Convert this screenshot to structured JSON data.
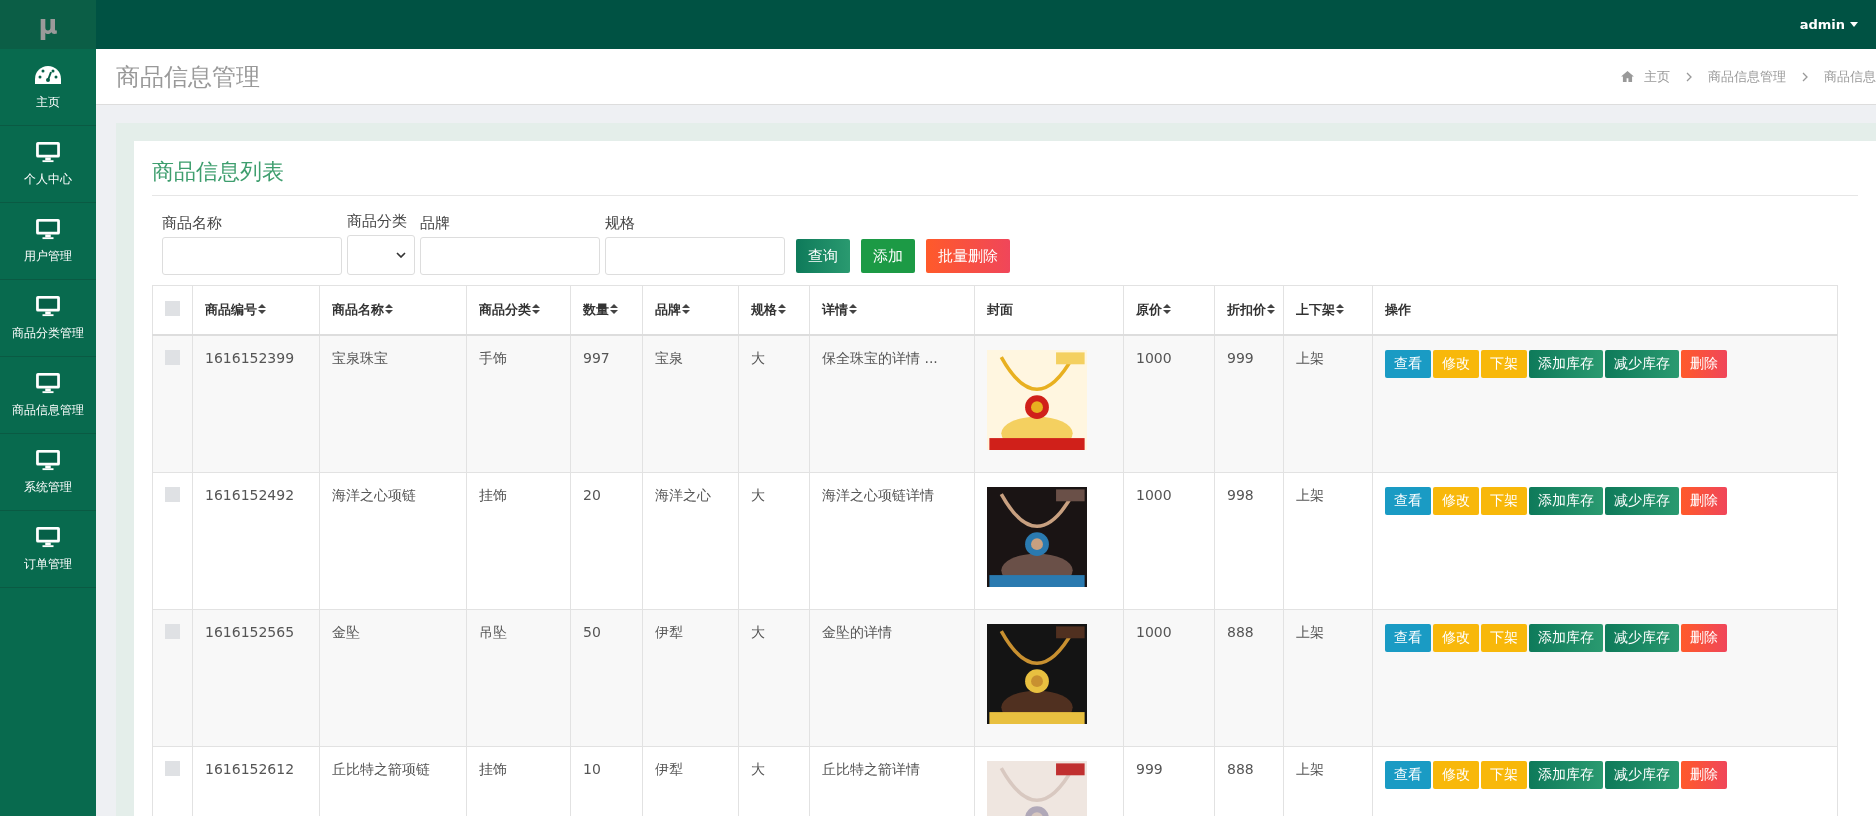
{
  "logo": "μ",
  "sidebar": {
    "items": [
      {
        "label": "主页",
        "selected": false
      },
      {
        "label": "个人中心",
        "selected": false
      },
      {
        "label": "用户管理",
        "selected": false
      },
      {
        "label": "商品分类管理",
        "selected": false
      },
      {
        "label": "商品信息管理",
        "selected": false
      },
      {
        "label": "系统管理",
        "selected": false
      },
      {
        "label": "订单管理",
        "selected": false
      }
    ]
  },
  "topbar": {
    "user": "admin"
  },
  "page_title": "商品信息管理",
  "breadcrumb": [
    "主页",
    "商品信息管理",
    "商品信息"
  ],
  "card_title": "商品信息列表",
  "filters": [
    {
      "label": "商品名称",
      "kind": "text"
    },
    {
      "label": "商品分类",
      "kind": "select"
    },
    {
      "label": "品牌",
      "kind": "text"
    },
    {
      "label": "规格",
      "kind": "text"
    }
  ],
  "actions": [
    {
      "label": "查询",
      "kind": "search"
    },
    {
      "label": "添加",
      "kind": "add"
    },
    {
      "label": "批量删除",
      "kind": "danger"
    }
  ],
  "table": {
    "all_checked": false,
    "columns": [
      {
        "label": "商品编号",
        "sortable": true
      },
      {
        "label": "商品名称",
        "sortable": true
      },
      {
        "label": "商品分类",
        "sortable": true
      },
      {
        "label": "数量",
        "sortable": true
      },
      {
        "label": "品牌",
        "sortable": true
      },
      {
        "label": "规格",
        "sortable": true
      },
      {
        "label": "详情",
        "sortable": true
      },
      {
        "label": "封面",
        "sortable": false
      },
      {
        "label": "原价",
        "sortable": true
      },
      {
        "label": "折扣价",
        "sortable": true
      },
      {
        "label": "上下架",
        "sortable": true
      },
      {
        "label": "操作",
        "sortable": false
      }
    ],
    "rows": [
      {
        "checked": false,
        "cells": [
          "1616152399",
          "宝泉珠宝",
          "手饰",
          "997",
          "宝泉",
          "大",
          "保全珠宝的详情 ...",
          "",
          "1000",
          "999",
          "上架"
        ],
        "cover": {
          "kind": "picture"
        },
        "buttons": [
          {
            "label": "查看",
            "kind": "info"
          },
          {
            "label": "修改",
            "kind": "warning"
          },
          {
            "label": "下架",
            "kind": "warning"
          },
          {
            "label": "添加库存",
            "kind": "success"
          },
          {
            "label": "减少库存",
            "kind": "success"
          },
          {
            "label": "删除",
            "kind": "danger"
          }
        ]
      },
      {
        "checked": false,
        "cells": [
          "1616152492",
          "海洋之心项链",
          "挂饰",
          "20",
          "海洋之心",
          "大",
          "海洋之心项链详情",
          "",
          "1000",
          "998",
          "上架"
        ],
        "cover": {
          "kind": "picture"
        },
        "buttons": [
          {
            "label": "查看",
            "kind": "info"
          },
          {
            "label": "修改",
            "kind": "warning"
          },
          {
            "label": "下架",
            "kind": "warning"
          },
          {
            "label": "添加库存",
            "kind": "success"
          },
          {
            "label": "减少库存",
            "kind": "success"
          },
          {
            "label": "删除",
            "kind": "danger"
          }
        ]
      },
      {
        "checked": false,
        "cells": [
          "1616152565",
          "金坠",
          "吊坠",
          "50",
          "伊犁",
          "大",
          "金坠的详情",
          "",
          "1000",
          "888",
          "上架"
        ],
        "cover": {
          "kind": "picture"
        },
        "buttons": [
          {
            "label": "查看",
            "kind": "info"
          },
          {
            "label": "修改",
            "kind": "warning"
          },
          {
            "label": "下架",
            "kind": "warning"
          },
          {
            "label": "添加库存",
            "kind": "success"
          },
          {
            "label": "减少库存",
            "kind": "success"
          },
          {
            "label": "删除",
            "kind": "danger"
          }
        ]
      },
      {
        "checked": false,
        "cells": [
          "1616152612",
          "丘比特之箭项链",
          "挂饰",
          "10",
          "伊犁",
          "大",
          "丘比特之箭详情",
          "",
          "999",
          "888",
          "上架"
        ],
        "cover": {
          "kind": "picture"
        },
        "buttons": [
          {
            "label": "查看",
            "kind": "info"
          },
          {
            "label": "修改",
            "kind": "warning"
          },
          {
            "label": "下架",
            "kind": "warning"
          },
          {
            "label": "添加库存",
            "kind": "success"
          },
          {
            "label": "减少库存",
            "kind": "success"
          },
          {
            "label": "删除",
            "kind": "danger"
          }
        ]
      }
    ]
  }
}
